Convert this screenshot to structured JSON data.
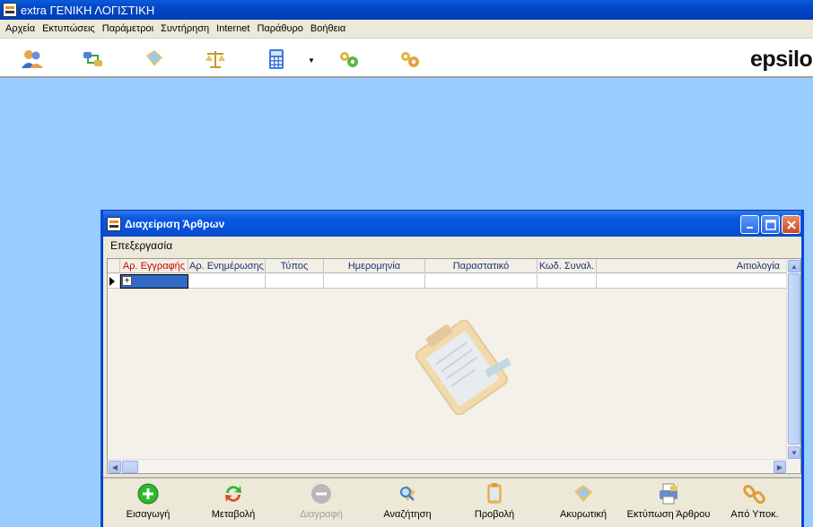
{
  "app": {
    "title": "extra ΓΕΝΙΚΗ ΛΟΓΙΣΤΙΚΗ",
    "brand": "epsilon"
  },
  "menubar": {
    "items": [
      "Αρχεία",
      "Εκτυπώσεις",
      "Παράμετροι",
      "Συντήρηση",
      "Internet",
      "Παράθυρο",
      "Βοήθεια"
    ]
  },
  "toolbar": {
    "icons": [
      "users-icon",
      "transfer-icon",
      "ledger-card-icon",
      "balance-scale-icon",
      "calculator-icon",
      "gears-green-icon",
      "gears-orange-icon"
    ]
  },
  "child_window": {
    "title": "Διαχείριση Άρθρων",
    "menu": [
      "Επεξεργασία"
    ],
    "grid": {
      "columns": [
        "Αρ. Εγγραφής",
        "Αρ. Ενημέρωσης",
        "Τύπος",
        "Ημερομηνία",
        "Παραστατικό",
        "Κωδ. Συναλ.",
        "Αιτιολογία"
      ],
      "active_column": "Αρ. Εγγραφής",
      "expand_symbol": "+"
    },
    "actions": [
      {
        "label": "Εισαγωγή",
        "icon": "add-icon",
        "enabled": true
      },
      {
        "label": "Μεταβολή",
        "icon": "refresh-icon",
        "enabled": true
      },
      {
        "label": "Διαγραφή",
        "icon": "remove-icon",
        "enabled": false
      },
      {
        "label": "Αναζήτηση",
        "icon": "search-icon",
        "enabled": true
      },
      {
        "label": "Προβολή",
        "icon": "view-icon",
        "enabled": true
      },
      {
        "label": "Ακυρωτική",
        "icon": "cancel-entry-icon",
        "enabled": true
      },
      {
        "label": "Εκτύπωση Άρθρου",
        "icon": "print-icon",
        "enabled": true
      },
      {
        "label": "Από Υποκ.",
        "icon": "link-icon",
        "enabled": true
      }
    ]
  },
  "colors": {
    "desktop": "#99ccff",
    "titlebar": "#0553dc",
    "active_column": "#cc0000"
  }
}
